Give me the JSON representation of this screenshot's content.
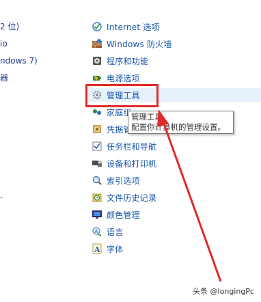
{
  "left_column": {
    "items": [
      "2 位)",
      "io",
      "ndows 7)",
      "器",
      "-"
    ]
  },
  "control_panel": {
    "items": [
      {
        "label": "Internet 选项",
        "icon": "internet-options-icon"
      },
      {
        "label": "Windows 防火墙",
        "icon": "firewall-icon"
      },
      {
        "label": "程序和功能",
        "icon": "programs-icon"
      },
      {
        "label": "电源选项",
        "icon": "power-icon"
      },
      {
        "label": "管理工具",
        "icon": "admin-tools-icon"
      },
      {
        "label": "家庭组",
        "icon": "homegroup-icon"
      },
      {
        "label": "凭据管理器",
        "icon": "credential-manager-icon"
      },
      {
        "label": "任务栏和导航",
        "icon": "taskbar-icon"
      },
      {
        "label": "设备和打印机",
        "icon": "devices-printers-icon"
      },
      {
        "label": "索引选项",
        "icon": "indexing-icon"
      },
      {
        "label": "文件历史记录",
        "icon": "file-history-icon"
      },
      {
        "label": "颜色管理",
        "icon": "color-management-icon"
      },
      {
        "label": "语言",
        "icon": "language-icon"
      },
      {
        "label": "字体",
        "icon": "fonts-icon"
      }
    ]
  },
  "tooltip": {
    "title": "管理工具",
    "description": "配置你计算机的管理设置。"
  },
  "watermark": "头条 @longingPc",
  "colors": {
    "link": "#1a56a8",
    "highlight": "#e02a2a",
    "hover_bg": "#e5f1fb"
  }
}
